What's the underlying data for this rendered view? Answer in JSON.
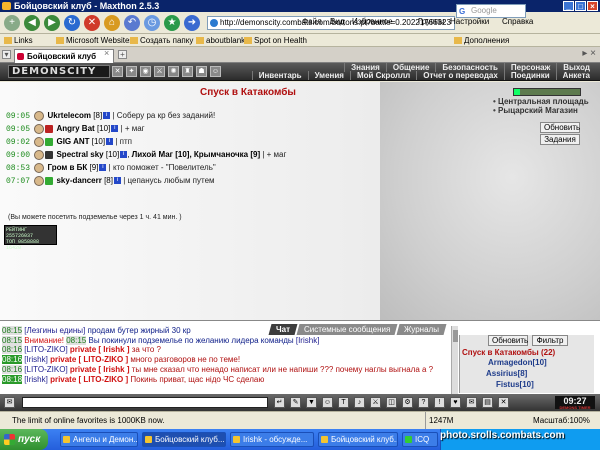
{
  "window": {
    "title": "Бойцовский клуб - Maxthon 2.5.3"
  },
  "menu": {
    "items": [
      "Файл",
      "Вид",
      "Избранное",
      "Группы",
      "Настройки",
      "Справка"
    ]
  },
  "address": {
    "url": "http://demonscity.combats.com/buttons.pl?battle=0.20221766323"
  },
  "search": {
    "placeholder": "Google"
  },
  "bookmarks": {
    "items": [
      "Links",
      "Microsoft Websites",
      "Создать папку",
      "aboutblank",
      "Spot on Health"
    ],
    "addons": "Дополнения"
  },
  "tabs": [
    {
      "label": "Бойцовский клуб"
    }
  ],
  "game": {
    "logo_text": "DEMONSCITY",
    "nav_top": [
      "Знания",
      "Общение",
      "Безопасность",
      "Персонаж",
      "Выход"
    ],
    "nav_bottom": [
      "Инвентарь",
      "Умения",
      "Мой Скроллл",
      "Отчет о переводах",
      "Поединки",
      "Анкета"
    ],
    "location_title": "Спуск в Катакомбы",
    "exits": [
      "Центральная площадь",
      "Рыцарский Магазин"
    ],
    "refresh_button": "Обновить",
    "quests_button": "Задания",
    "players": [
      {
        "time": "09:05",
        "name": "Ukrtelecom",
        "level": "[8]",
        "msg": "| Соберу ра кр без заданий!"
      },
      {
        "time": "09:05",
        "name": "Angry Bat",
        "level": "[10]",
        "msg": "| + маг"
      },
      {
        "time": "09:02",
        "name": "GIG ANT",
        "level": "[10]",
        "msg": "| птп"
      },
      {
        "time": "09:00",
        "name": "Spectral sky",
        "level": "[10]",
        "extra": "Лихой Маг [10], Крымчаночка [9]",
        "msg": "| + маг"
      },
      {
        "time": "08:53",
        "name": "Гром в БК",
        "level": "[9]",
        "msg": "| кто поможет - \"Повелитель\""
      },
      {
        "time": "07:07",
        "name": "sky-dancerr",
        "level": "[8]",
        "msg": "| цепанусь любым путем"
      }
    ],
    "descend_note": "(Вы можете посетить подземелье через 1 ч. 41 мин. )",
    "counter_lines": [
      "РЕЙТИНГ 255726037",
      "ТОП 0858888",
      "16420"
    ]
  },
  "chat": {
    "tabs": [
      "Чат",
      "Системные сообщения",
      "Журналы"
    ],
    "messages": [
      {
        "time": "08:15",
        "name": "[Лезгины едины]",
        "text": "продам бутер жирный 30 кр"
      },
      {
        "time": "08:15",
        "sys": "Внимание!",
        "time2": "08:15",
        "text": "Вы покинули подземелье по желанию лидера команды",
        "name": "[Irishk]"
      },
      {
        "time": "08:16",
        "name": "[LITO-ZIKO]",
        "priv": "private [ Irishk ]",
        "text": "за что ?"
      },
      {
        "time": "08:16",
        "name": "[Irishk]",
        "priv": "private [ LITO-ZIKO ]",
        "text": "много разговоров не по теме!"
      },
      {
        "time": "08:16",
        "name": "[LITO-ZIKO]",
        "priv": "private [ Irishk ]",
        "text": "ты мне сказал что ненадо написат или не напиши ??? почему наглы выгнала а ?"
      },
      {
        "time": "08:18",
        "name": "[Irishk]",
        "priv": "private [ LITO-ZIKO ]",
        "text": "Покинь приват, щас нідо ЧС сделаю"
      }
    ],
    "panel_refresh": "Обновить",
    "panel_filter": "Фильтр",
    "room_title": "Спуск в Катакомбы (22)",
    "room_users": [
      "Armagedon[10]",
      "Assirius[8]",
      "Fistus[10]"
    ]
  },
  "clock": {
    "time": "09:27",
    "sub": "DEMONS TIMER"
  },
  "status": {
    "text": "The limit of online favorites is 1000KB now.",
    "memory": "1247M",
    "zoom": "Масштаб:100%"
  },
  "taskbar": {
    "start": "пуск",
    "tasks": [
      "Ангелы и Демон...",
      "Бойцовский клуб...",
      "Irishk - обсужде...",
      "Бойцовский клуб...",
      "ICQ"
    ],
    "watermark": "photo.srolls.combats.com"
  }
}
